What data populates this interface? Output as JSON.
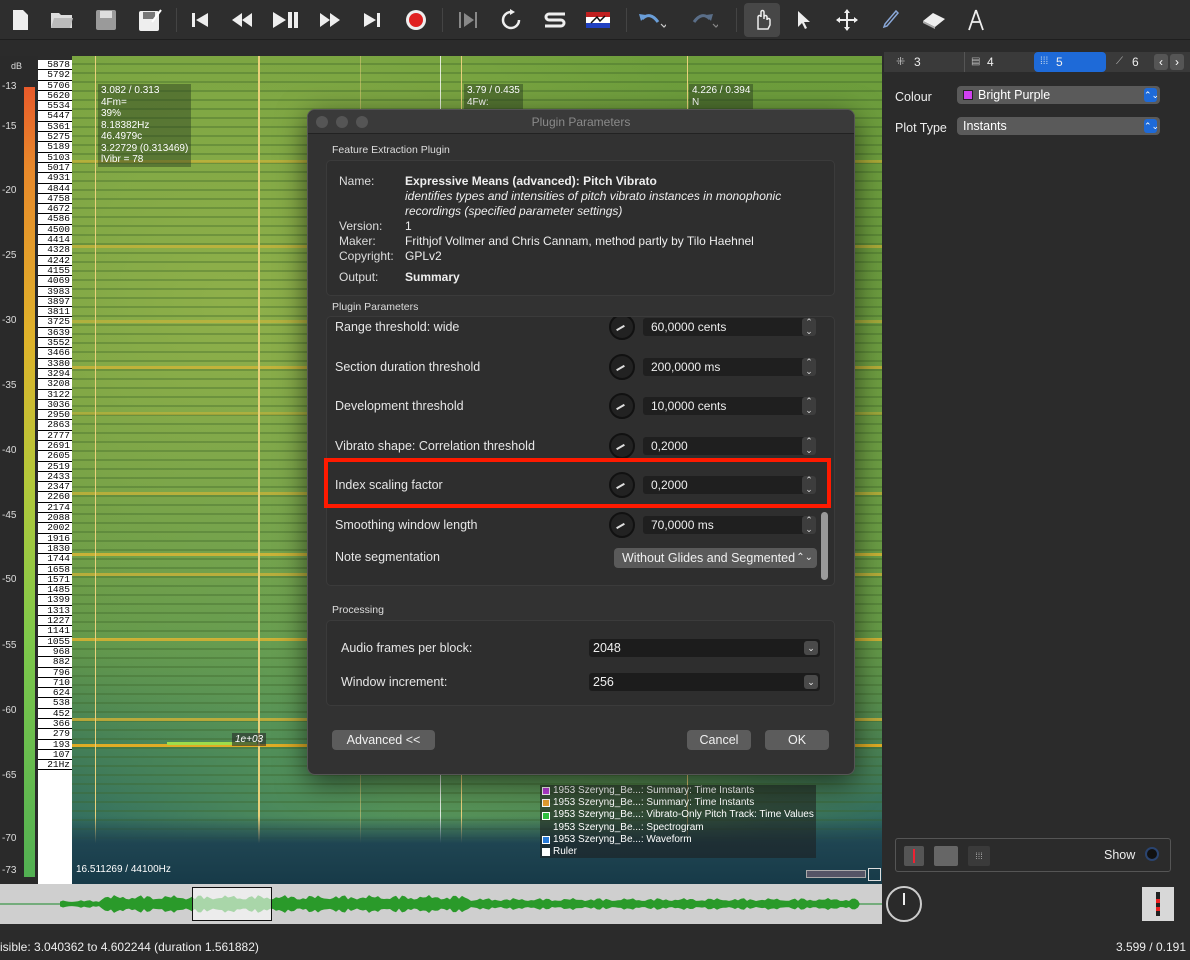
{
  "toolbar": {
    "items": [
      "new-file",
      "open-folder",
      "save",
      "save-as",
      "rewind-start",
      "rewind",
      "play-pause",
      "fast-forward",
      "forward-end",
      "record",
      "play-selection",
      "loop",
      "solo",
      "normalize",
      "undo",
      "redo",
      "navigate",
      "select",
      "move",
      "draw",
      "erase",
      "measure"
    ]
  },
  "scale": {
    "db_title": "dB",
    "db_labels": [
      "-13",
      "-15",
      "-20",
      "-25",
      "-30",
      "-35",
      "-40",
      "-45",
      "-50",
      "-55",
      "-60",
      "-65",
      "-70",
      "-73"
    ],
    "hz_labels": [
      "5878",
      "5792",
      "5706",
      "5620",
      "5534",
      "5447",
      "5361",
      "5275",
      "5189",
      "5103",
      "5017",
      "4931",
      "4844",
      "4758",
      "4672",
      "4586",
      "4500",
      "4414",
      "4328",
      "4242",
      "4155",
      "4069",
      "3983",
      "3897",
      "3811",
      "3725",
      "3639",
      "3552",
      "3466",
      "3380",
      "3294",
      "3208",
      "3122",
      "3036",
      "2950",
      "2863",
      "2777",
      "2691",
      "2605",
      "2519",
      "2433",
      "2347",
      "2260",
      "2174",
      "2088",
      "2002",
      "1916",
      "1830",
      "1744",
      "1658",
      "1571",
      "1485",
      "1399",
      "1313",
      "1227",
      "1141",
      "1055",
      "968",
      "882",
      "796",
      "710",
      "624",
      "538",
      "452",
      "366",
      "279",
      "193",
      "107",
      "21Hz"
    ]
  },
  "overlay": {
    "a": [
      "3.082 / 0.313",
      "4Fm=",
      "39%",
      "8.18382Hz",
      "46.4979c",
      "3.22729 (0.313469)",
      "lVibr = 78"
    ],
    "b": [
      "3.79 / 0.435",
      "4Fw:"
    ],
    "c": [
      "4.226 / 0.394",
      "N"
    ],
    "scale_label": "1e+03",
    "freq_readout": "16.511269 / 44100Hz"
  },
  "legend": [
    {
      "label": "1953 Szeryng_Be...: Summary: Time Instants",
      "color": "#c040e0"
    },
    {
      "label": "1953 Szeryng_Be...: Summary: Time Instants",
      "color": "#e8a030"
    },
    {
      "label": "1953 Szeryng_Be...: Vibrato-Only Pitch Track: Time Values",
      "color": "#30c040"
    },
    {
      "label": "1953 Szeryng_Be...: Spectrogram",
      "color": ""
    },
    {
      "label": "1953 Szeryng_Be...: Waveform",
      "color": "#2a7ad8"
    },
    {
      "label": "Ruler",
      "color": "#ffffff"
    }
  ],
  "dialog": {
    "title": "Plugin Parameters",
    "section1": "Feature Extraction Plugin",
    "name_label": "Name:",
    "name_value": "Expressive Means (advanced): Pitch Vibrato",
    "description": "identifies types and intensities of pitch vibrato instances in monophonic recordings (specified parameter settings)",
    "version_label": "Version:",
    "version_value": "1",
    "maker_label": "Maker:",
    "maker_value": "Frithjof Vollmer and Chris Cannam, method partly by Tilo Haehnel",
    "copyright_label": "Copyright:",
    "copyright_value": "GPLv2",
    "output_label": "Output:",
    "output_value": "Summary",
    "section2": "Plugin Parameters",
    "params": [
      {
        "label": "Range threshold: wide",
        "value": "60,0000 cents"
      },
      {
        "label": "Section duration threshold",
        "value": "200,0000 ms"
      },
      {
        "label": "Development threshold",
        "value": "10,0000 cents"
      },
      {
        "label": "Vibrato shape: Correlation threshold",
        "value": "0,2000"
      },
      {
        "label": "Index scaling factor",
        "value": "0,2000"
      },
      {
        "label": "Smoothing window length",
        "value": "70,0000 ms"
      }
    ],
    "note_label": "Note segmentation",
    "note_value": "Without Glides and Segmented",
    "section3": "Processing",
    "frames_label": "Audio frames per block:",
    "frames_value": "2048",
    "increment_label": "Window increment:",
    "increment_value": "256",
    "advanced_btn": "Advanced <<",
    "cancel_btn": "Cancel",
    "ok_btn": "OK"
  },
  "panel": {
    "tabs": [
      "3",
      "4",
      "5",
      "6"
    ],
    "colour_label": "Colour",
    "colour_value": "Bright Purple",
    "colour_swatch": "#d040f0",
    "plot_label": "Plot Type",
    "plot_value": "Instants",
    "show_label": "Show"
  },
  "status": {
    "left": "isible: 3.040362 to 4.602244 (duration 1.561882)",
    "right": "3.599 / 0.191"
  },
  "colors": {
    "accent": "#1e6ad8",
    "highlight": "#ff1a00"
  }
}
